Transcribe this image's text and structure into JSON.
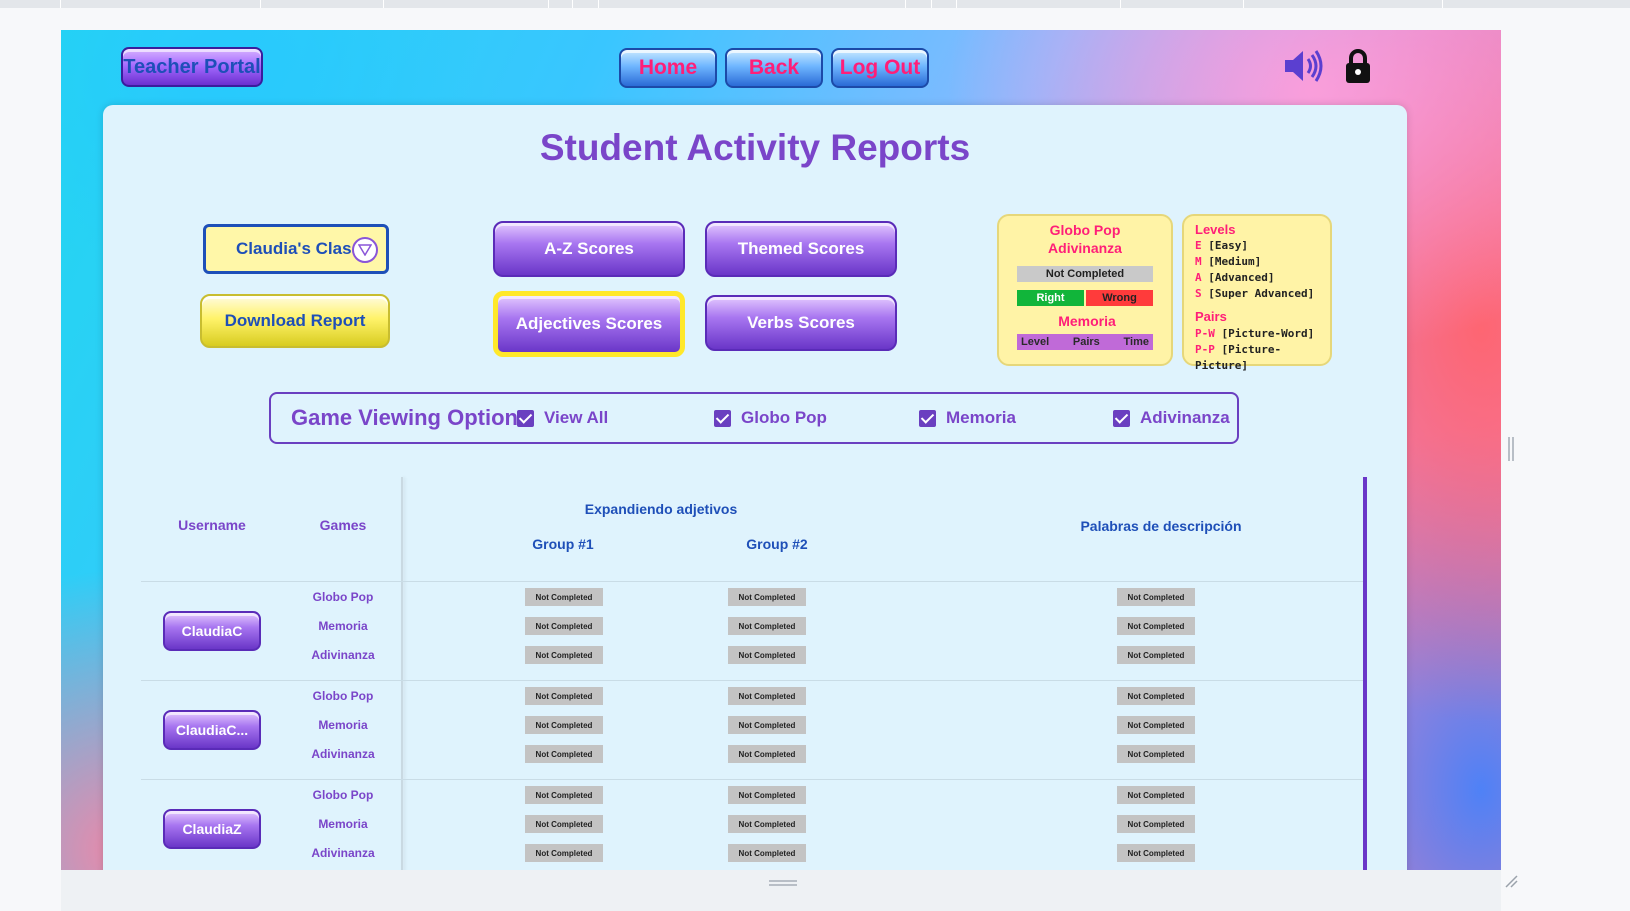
{
  "header": {
    "teacher_portal": "Teacher Portal",
    "nav": {
      "home": "Home",
      "back": "Back",
      "logout": "Log Out"
    }
  },
  "page_title": "Student Activity Reports",
  "class_select": {
    "value": "Claudia's Class"
  },
  "download_report": "Download Report",
  "score_buttons": {
    "az": "A-Z Scores",
    "themed": "Themed Scores",
    "adjectives": "Adjectives Scores",
    "verbs": "Verbs Scores"
  },
  "legend": {
    "globo_pop": "Globo Pop",
    "adivinanza": "Adivinanza",
    "not_completed": "Not Completed",
    "right": "Right",
    "wrong": "Wrong",
    "memoria": "Memoria",
    "memoria_cols": [
      "Level",
      "Pairs",
      "Time"
    ]
  },
  "levels": {
    "title": "Levels",
    "items": [
      {
        "key": "E",
        "text": "[Easy]"
      },
      {
        "key": "M",
        "text": "[Medium]"
      },
      {
        "key": "A",
        "text": "[Advanced]"
      },
      {
        "key": "S",
        "text": "[Super Advanced]"
      }
    ],
    "pairs_title": "Pairs",
    "pairs": [
      {
        "key": "P-W",
        "text": "[Picture-Word]"
      },
      {
        "key": "P-P",
        "text": "[Picture-Picture]"
      }
    ]
  },
  "viewing_options": {
    "label": "Game Viewing Options",
    "options": [
      "View All",
      "Globo Pop",
      "Memoria",
      "Adivinanza"
    ],
    "checked": [
      true,
      true,
      true,
      true
    ]
  },
  "table": {
    "col_username": "Username",
    "col_games": "Games",
    "expandiendo": "Expandiendo adjetivos",
    "group1": "Group #1",
    "group2": "Group #2",
    "palabras": "Palabras de descripción",
    "games": [
      "Globo Pop",
      "Memoria",
      "Adivinanza"
    ],
    "cell_status": "Not Completed",
    "students": [
      "ClaudiaC",
      "ClaudiaC...",
      "ClaudiaZ"
    ]
  },
  "colors": {
    "accent_purple": "#7a45c9",
    "blue_text": "#1e4fb8",
    "pink": "#ff1e78",
    "panel_bg": "#dff3fd"
  }
}
